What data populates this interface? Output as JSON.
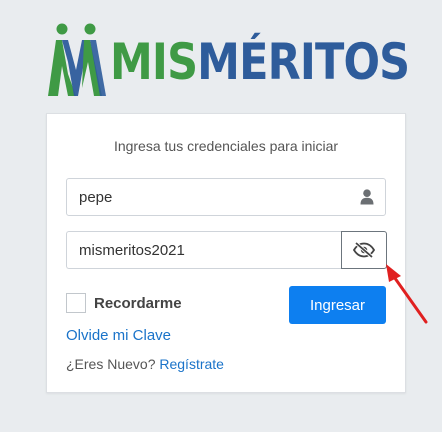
{
  "brand": {
    "name_part1": "MIS",
    "name_part2": "MÉRITOS",
    "colors": {
      "green": "#3f9a45",
      "blue": "#2e5c9b"
    },
    "icon": "two-people-logo-icon"
  },
  "login": {
    "title": "Ingresa tus credenciales para iniciar",
    "username": {
      "value": "pepe",
      "icon": "user-icon"
    },
    "password": {
      "value": "mismeritos2021",
      "toggle_icon": "eye-slash-icon"
    },
    "remember_label": "Recordarme",
    "submit_label": "Ingresar",
    "forgot_link": "Olvide mi Clave",
    "new_user_prompt": "¿Eres Nuevo?",
    "register_link": "Regístrate",
    "colors": {
      "primary": "#0d7ff0",
      "link": "#1a73c9",
      "annotation_arrow": "#e02020"
    }
  }
}
